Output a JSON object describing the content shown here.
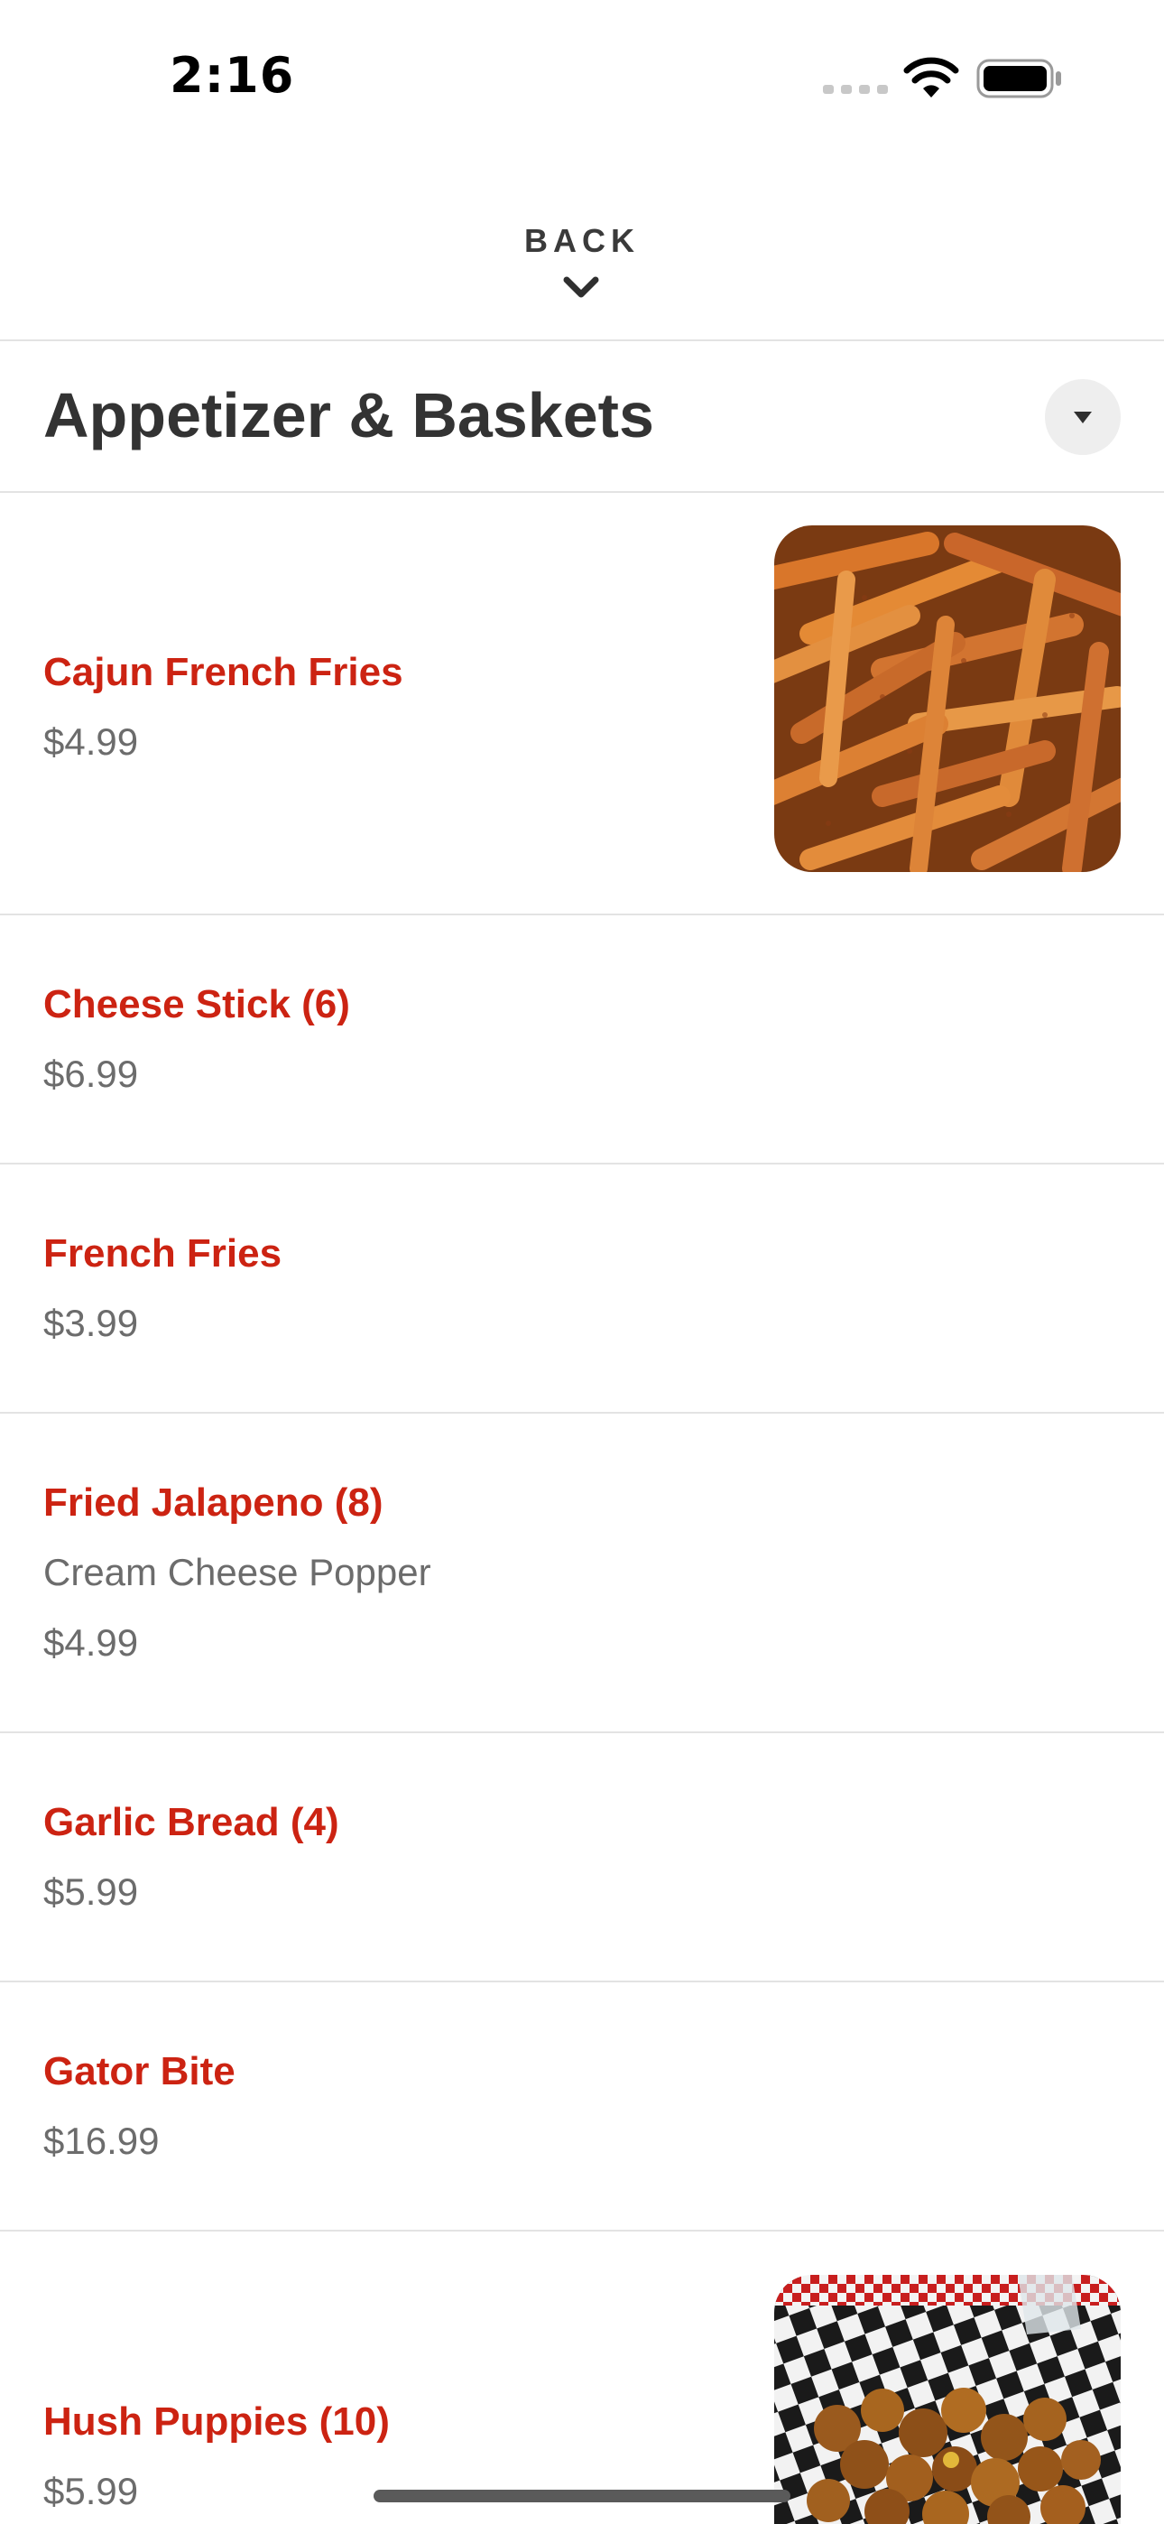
{
  "status": {
    "time": "2:16"
  },
  "nav": {
    "back_label": "BACK"
  },
  "category": {
    "title": "Appetizer & Baskets"
  },
  "items": [
    {
      "name": "Cajun French Fries",
      "description": "",
      "price": "$4.99",
      "has_photo": true,
      "photo": "cajun-fries-photo"
    },
    {
      "name": "Cheese Stick (6)",
      "description": "",
      "price": "$6.99",
      "has_photo": false
    },
    {
      "name": "French Fries",
      "description": "",
      "price": "$3.99",
      "has_photo": false
    },
    {
      "name": "Fried Jalapeno (8)",
      "description": "Cream Cheese Popper",
      "price": "$4.99",
      "has_photo": false
    },
    {
      "name": "Garlic Bread (4)",
      "description": "",
      "price": "$5.99",
      "has_photo": false
    },
    {
      "name": "Gator Bite",
      "description": "",
      "price": "$16.99",
      "has_photo": false
    },
    {
      "name": "Hush Puppies (10)",
      "description": "",
      "price": "$5.99",
      "has_photo": true,
      "photo": "hush-puppies-photo"
    }
  ],
  "colors": {
    "item_name": "#cc2312",
    "price_text": "#6c6c6c",
    "divider": "#e3e3e3",
    "title_text": "#333333"
  }
}
